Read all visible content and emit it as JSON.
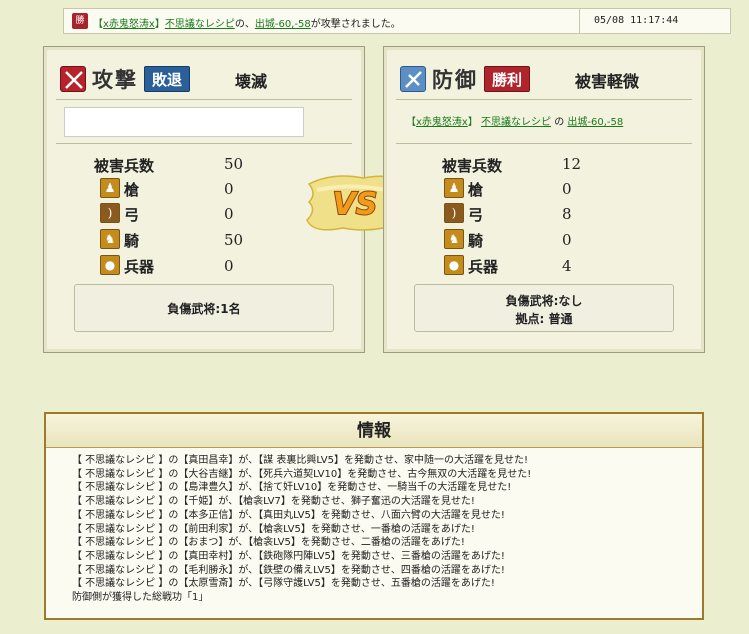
{
  "topbar": {
    "icon_label": "勝",
    "msg_open": "【",
    "player1": "x赤鬼怒涛x",
    "msg_close": "】",
    "player2": "不思議なレシピ",
    "msg_of": "の、",
    "location": "出城-60,-58",
    "msg_tail": "が攻撃されました。",
    "time": "05/08 11:17:44"
  },
  "attack": {
    "heading": "攻撃",
    "badge": "敗退",
    "badge_color": "#2b5f9a",
    "result": "壊滅",
    "casualties_label": "被害兵数",
    "casualties": "50",
    "units": [
      {
        "label": "槍",
        "value": "0",
        "icon": "spear-icon"
      },
      {
        "label": "弓",
        "value": "0",
        "icon": "bow-icon"
      },
      {
        "label": "騎",
        "value": "50",
        "icon": "horse-icon"
      },
      {
        "label": "兵器",
        "value": "0",
        "icon": "siege-icon"
      }
    ],
    "injured": "負傷武将:1名"
  },
  "defense": {
    "heading": "防御",
    "badge": "勝利",
    "badge_color": "#b0242c",
    "result": "被害軽微",
    "names_open": "【",
    "player1": "x赤鬼怒涛x",
    "names_mid": "】",
    "player2": "不思議なレシピ",
    "names_of": "の",
    "location": "出城-60,-58",
    "casualties_label": "被害兵数",
    "casualties": "12",
    "units": [
      {
        "label": "槍",
        "value": "0",
        "icon": "spear-icon"
      },
      {
        "label": "弓",
        "value": "8",
        "icon": "bow-icon"
      },
      {
        "label": "騎",
        "value": "0",
        "icon": "horse-icon"
      },
      {
        "label": "兵器",
        "value": "4",
        "icon": "siege-icon"
      }
    ],
    "injured": "負傷武将:なし",
    "base": "拠点: 普通"
  },
  "vs_label": "VS",
  "info": {
    "title": "情報",
    "lines": [
      "【 不思議なレシピ 】の【真田昌幸】が、【謀 表裏比興LV5】を発動させ、家中随一の大活躍を見せた!",
      "【 不思議なレシピ 】の【大谷吉継】が、【死兵六道契LV10】を発動させ、古今無双の大活躍を見せた!",
      "【 不思議なレシピ 】の【島津豊久】が、【捨て奸LV10】を発動させ、一騎当千の大活躍を見せた!",
      "【 不思議なレシピ 】の【千姫】が、【槍衾LV7】を発動させ、獅子奮迅の大活躍を見せた!",
      "【 不思議なレシピ 】の【本多正信】が、【真田丸LV5】を発動させ、八面六臂の大活躍を見せた!",
      "【 不思議なレシピ 】の【前田利家】が、【槍衾LV5】を発動させ、一番槍の活躍をあげた!",
      "【 不思議なレシピ 】の【おまつ】が、【槍衾LV5】を発動させ、二番槍の活躍をあげた!",
      "【 不思議なレシピ 】の【真田幸村】が、【鉄砲隊円陣LV5】を発動させ、三番槍の活躍をあげた!",
      "【 不思議なレシピ 】の【毛利勝永】が、【鉄壁の備えLV5】を発動させ、四番槍の活躍をあげた!",
      "【 不思議なレシピ 】の【太原雪斎】が、【弓隊守護LV5】を発動させ、五番槍の活躍をあげた!",
      "防御側が獲得した総戦功「1」"
    ]
  }
}
